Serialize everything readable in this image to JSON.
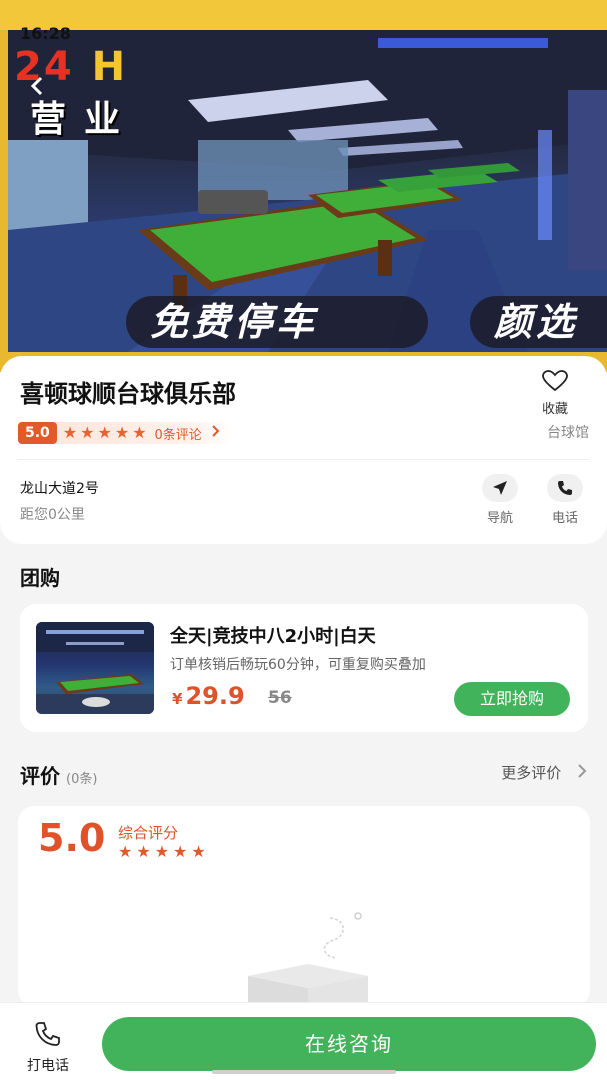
{
  "status_bar": {
    "time": "16:28"
  },
  "hero": {
    "badge_hours": "24",
    "badge_h": "H",
    "badge_open": "营业",
    "tag_parking": "免费停车",
    "tag_selection": "颜选"
  },
  "shop": {
    "name": "喜顿球顺台球俱乐部",
    "favorite_label": "收藏",
    "rating": "5.0",
    "stars": [
      "★",
      "★",
      "★",
      "★",
      "★"
    ],
    "review_count_text": "0条评论",
    "category": "台球馆",
    "address": "龙山大道2号",
    "distance": "距您0公里",
    "nav_label": "导航",
    "phone_label": "电话"
  },
  "group_buy": {
    "title": "团购",
    "deal": {
      "title": "全天|竞技中八2小时|白天",
      "desc": "订单核销后畅玩60分钟，可重复购买叠加",
      "currency": "¥",
      "price": "29.9",
      "original_price": "56",
      "buy_label": "立即抢购"
    }
  },
  "reviews": {
    "title": "评价",
    "count": "(0条)",
    "more_label": "更多评价",
    "score": "5.0",
    "score_label": "综合评分",
    "stars": [
      "★",
      "★",
      "★",
      "★",
      "★"
    ]
  },
  "bottom_bar": {
    "call_label": "打电话",
    "consult_label": "在线咨询"
  },
  "colors": {
    "accent_orange": "#e0532a",
    "accent_green": "#43b35b",
    "hero_yellow": "#f2c73a"
  }
}
